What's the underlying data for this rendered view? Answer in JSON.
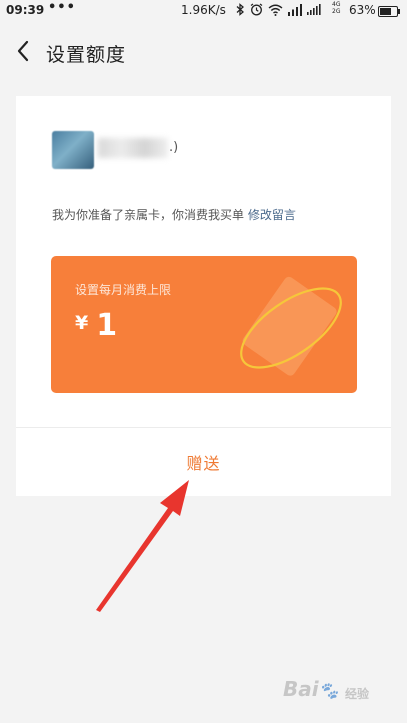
{
  "status_bar": {
    "time": "09:39",
    "dots": "•••",
    "net_speed": "1.96K/s",
    "network_labels": "4G 2G",
    "battery": "63%"
  },
  "header": {
    "back_icon": "chevron-left-icon",
    "title": "设置额度"
  },
  "card": {
    "recipient_suffix": ".)",
    "message_text": "我为你准备了亲属卡，你消费我买单",
    "edit_link": "修改留言",
    "limit_label": "设置每月消费上限",
    "currency": "¥",
    "limit_amount": "1",
    "gift_button": "赠送"
  },
  "colors": {
    "accent_orange": "#f77f3a",
    "link_blue": "#4b6a8c",
    "arrow_red": "#e8352e"
  },
  "watermark": {
    "brand": "Bai",
    "suffix": "du",
    "jingyan": "经验"
  }
}
